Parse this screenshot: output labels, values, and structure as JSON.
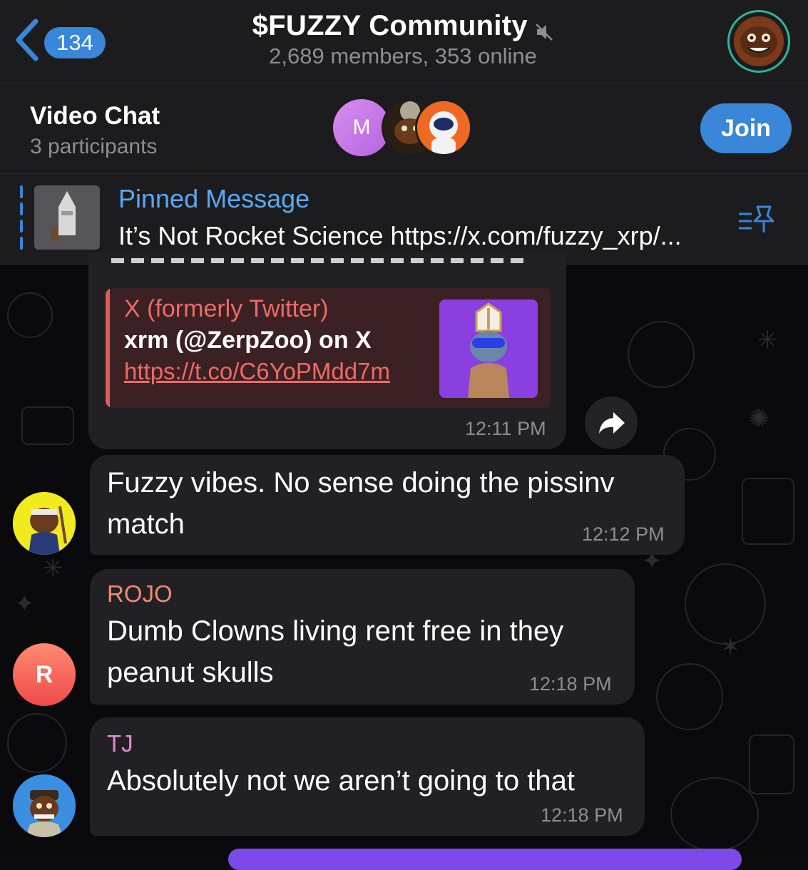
{
  "header": {
    "back_count": "134",
    "title": "$FUZZY Community",
    "subtitle": "2,689 members, 353 online",
    "muted_icon": "muted-speaker-icon",
    "accent": "#3a86d8"
  },
  "video_chat": {
    "title": "Video Chat",
    "participants": "3 participants",
    "participant_initial": "M",
    "join_label": "Join"
  },
  "pinned": {
    "label": "Pinned Message",
    "text": "It’s Not Rocket Science https://x.com/fuzzy_xrp/..."
  },
  "messages": [
    {
      "preview": {
        "source": "X (formerly Twitter)",
        "title": "xrm (@ZerpZoo) on X",
        "link": "https://t.co/C6YoPMdd7m"
      },
      "time": "12:11 PM"
    },
    {
      "text": "Fuzzy vibes. No sense doing the pissinv match",
      "line1": "Fuzzy vibes. No sense doing the pissinv",
      "line2": "match",
      "time": "12:12 PM"
    },
    {
      "sender": "ROJO",
      "sender_color": "#f08a6e",
      "avatar_initial": "R",
      "line1": "Dumb Clowns living rent free in they",
      "line2": "peanut skulls",
      "time": "12:18 PM"
    },
    {
      "sender": "TJ",
      "sender_color": "#e58ad0",
      "line1": "Absolutely not we aren’t going to that",
      "time": "12:18 PM"
    }
  ]
}
